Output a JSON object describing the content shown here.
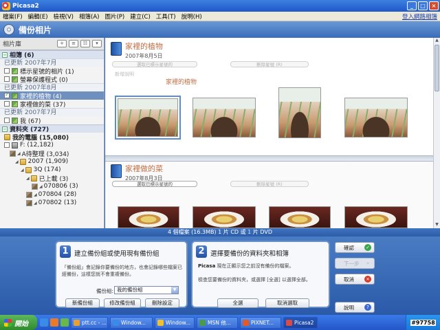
{
  "window": {
    "title": "Picasa2"
  },
  "menu": [
    "檔案(F)",
    "編輯(E)",
    "檢視(V)",
    "相簿(A)",
    "圖片(P)",
    "建立(C)",
    "工具(T)",
    "說明(H)"
  ],
  "menu_link": "登入網路相簿",
  "header": {
    "title": "備份相片"
  },
  "sidebar": {
    "title": "相片庫",
    "albums_head": "相簿 (6)",
    "albums": [
      {
        "kind": "date",
        "label": "已更新 2007年7月"
      },
      {
        "kind": "item",
        "label": "標示星號的相片 (1)",
        "checked": false,
        "selected": false
      },
      {
        "kind": "item",
        "label": "螢幕保護程式 (0)",
        "checked": false,
        "selected": false
      },
      {
        "kind": "date",
        "label": "已更新 2007年8月"
      },
      {
        "kind": "item",
        "label": "家裡的植物 (4)",
        "checked": true,
        "selected": true
      },
      {
        "kind": "item",
        "label": "家裡做的菜 (37)",
        "checked": false,
        "selected": false
      },
      {
        "kind": "date",
        "label": "已更新 2007年7月"
      },
      {
        "kind": "item",
        "label": "我 (67)",
        "checked": false,
        "selected": false
      }
    ],
    "folders_head": "資料夾 (727)",
    "folders": [
      {
        "label": "我的電腦 (15,080)",
        "bold": true,
        "indent": 0,
        "icon": "folder",
        "cb": false
      },
      {
        "label": "F: (12,182)",
        "bold": false,
        "indent": 0,
        "icon": "drive",
        "cb": true
      },
      {
        "label": "A待整理 (3,034)",
        "bold": false,
        "indent": 1,
        "icon": "photo",
        "cb": true
      },
      {
        "label": "2007 (1,909)",
        "bold": false,
        "indent": 2,
        "icon": "folder",
        "cb": false
      },
      {
        "label": "3Q (174)",
        "bold": false,
        "indent": 3,
        "icon": "folder",
        "cb": false
      },
      {
        "label": "已上載 (3)",
        "bold": false,
        "indent": 4,
        "icon": "folder",
        "cb": false
      },
      {
        "label": "070806 (3)",
        "bold": false,
        "indent": 5,
        "icon": "photo",
        "cb": true
      },
      {
        "label": "070804 (28)",
        "bold": false,
        "indent": 4,
        "icon": "photo",
        "cb": true
      },
      {
        "label": "070802 (13)",
        "bold": false,
        "indent": 4,
        "icon": "photo",
        "cb": true
      }
    ]
  },
  "albums_view": [
    {
      "title": "家裡的植物",
      "date": "2007年8月5日",
      "pill1": "選取已標示星號的",
      "pill2": "刪除星號 (R)",
      "desc": "新增說明",
      "extra_title": "家裡的植物"
    },
    {
      "title": "家裡做的菜",
      "date": "2007年8月3日",
      "pill1": "選取已標示星號的",
      "pill2": "刪除星號 (R)"
    }
  ],
  "status": {
    "pre": "4 個檔案 (16.3MB) 1 片 CD 或 ",
    "mid": "1",
    "post": " 片 DVD"
  },
  "step1": {
    "num": "1",
    "title": "建立備份組或使用現有備份組",
    "text": "「備份組」會記錄你要備份的地方，也會記錄哪些檔案已經備份，這樣您就不會重複備份。",
    "select_label": "備份組:",
    "select_value": "我的備份組",
    "btn_new": "新備份組",
    "btn_edit": "修改備份組",
    "btn_delete": "刪除設定"
  },
  "step2": {
    "num": "2",
    "title": "選擇要備份的資料夾和相簿",
    "text1_b": "Picasa",
    "text1": " 現在正顯示您之前沒有備份的檔案。",
    "text2": "檢查您要備份的資料夾，或選擇 [全選] 以選擇全部。",
    "btn_all": "全選",
    "btn_none": "取消選取"
  },
  "side_buttons": {
    "ok": "確認",
    "next": "下一步",
    "cancel": "取消",
    "help": "說明"
  },
  "taskbar": {
    "start": "開始",
    "tasks": [
      {
        "label": "ptt.cc - ..."
      },
      {
        "label": "Window..."
      },
      {
        "label": "Window..."
      },
      {
        "label": "MSN 他..."
      },
      {
        "label": "PIXNET..."
      },
      {
        "label": "Picasa2"
      }
    ],
    "tray": "#97758"
  }
}
